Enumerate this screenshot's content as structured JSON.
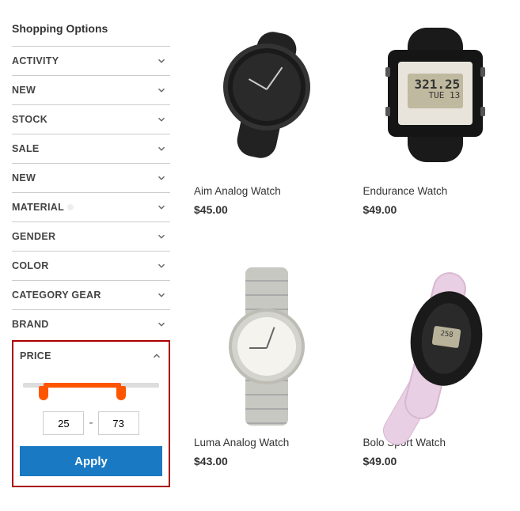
{
  "sidebar": {
    "title": "Shopping Options",
    "filters": [
      {
        "label": "ACTIVITY",
        "expanded": false
      },
      {
        "label": "NEW",
        "expanded": false
      },
      {
        "label": "STOCK",
        "expanded": false
      },
      {
        "label": "SALE",
        "expanded": false
      },
      {
        "label": "NEW",
        "expanded": false
      },
      {
        "label": "MATERIAL",
        "expanded": false,
        "hasDot": true
      },
      {
        "label": "GENDER",
        "expanded": false
      },
      {
        "label": "COLOR",
        "expanded": false
      },
      {
        "label": "CATEGORY GEAR",
        "expanded": false
      },
      {
        "label": "BRAND",
        "expanded": false
      }
    ],
    "price": {
      "label": "PRICE",
      "min": "25",
      "max": "73",
      "apply_label": "Apply"
    }
  },
  "products": [
    {
      "name": "Aim Analog Watch",
      "price": "$45.00",
      "variant": "aim"
    },
    {
      "name": "Endurance Watch",
      "price": "$49.00",
      "variant": "end",
      "digital_line1": "321.25",
      "digital_line2": "TUE 13"
    },
    {
      "name": "Luma Analog Watch",
      "price": "$43.00",
      "variant": "luma"
    },
    {
      "name": "Bolo Sport Watch",
      "price": "$49.00",
      "variant": "bolo",
      "digital_line1": "258"
    }
  ]
}
